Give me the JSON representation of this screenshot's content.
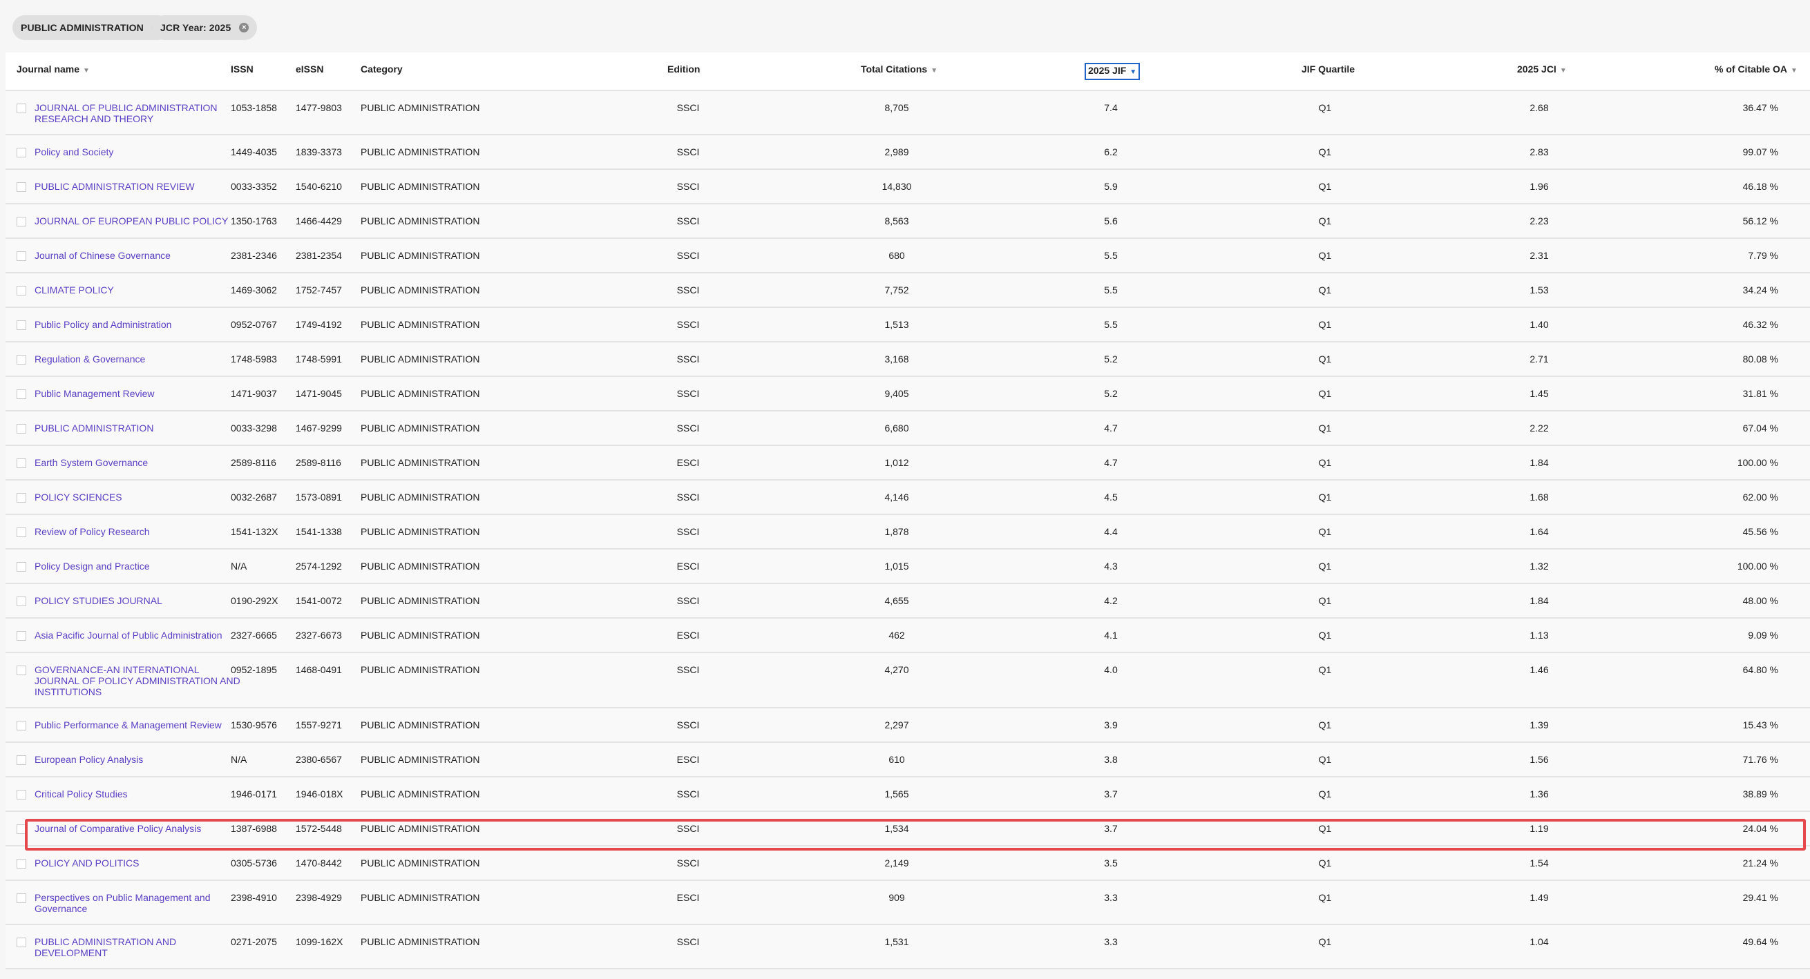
{
  "filters": [
    {
      "label": "PUBLIC ADMINISTRATION"
    },
    {
      "label": "JCR Year: 2025"
    }
  ],
  "columns": {
    "journal": "Journal name",
    "issn": "ISSN",
    "eissn": "eISSN",
    "category": "Category",
    "edition": "Edition",
    "citations": "Total Citations",
    "jif": "2025 JIF",
    "quartile": "JIF Quartile",
    "jci": "2025 JCI",
    "oa": "% of Citable OA"
  },
  "rows": [
    {
      "name": "JOURNAL OF PUBLIC ADMINISTRATION RESEARCH AND THEORY",
      "issn": "1053-1858",
      "eissn": "1477-9803",
      "category": "PUBLIC ADMINISTRATION",
      "edition": "SSCI",
      "citations": "8,705",
      "jif": "7.4",
      "quartile": "Q1",
      "jci": "2.68",
      "oa": "36.47 %"
    },
    {
      "name": "Policy and Society",
      "issn": "1449-4035",
      "eissn": "1839-3373",
      "category": "PUBLIC ADMINISTRATION",
      "edition": "SSCI",
      "citations": "2,989",
      "jif": "6.2",
      "quartile": "Q1",
      "jci": "2.83",
      "oa": "99.07 %"
    },
    {
      "name": "PUBLIC ADMINISTRATION REVIEW",
      "issn": "0033-3352",
      "eissn": "1540-6210",
      "category": "PUBLIC ADMINISTRATION",
      "edition": "SSCI",
      "citations": "14,830",
      "jif": "5.9",
      "quartile": "Q1",
      "jci": "1.96",
      "oa": "46.18 %"
    },
    {
      "name": "JOURNAL OF EUROPEAN PUBLIC POLICY",
      "issn": "1350-1763",
      "eissn": "1466-4429",
      "category": "PUBLIC ADMINISTRATION",
      "edition": "SSCI",
      "citations": "8,563",
      "jif": "5.6",
      "quartile": "Q1",
      "jci": "2.23",
      "oa": "56.12 %"
    },
    {
      "name": "Journal of Chinese Governance",
      "issn": "2381-2346",
      "eissn": "2381-2354",
      "category": "PUBLIC ADMINISTRATION",
      "edition": "SSCI",
      "citations": "680",
      "jif": "5.5",
      "quartile": "Q1",
      "jci": "2.31",
      "oa": "7.79 %"
    },
    {
      "name": "CLIMATE POLICY",
      "issn": "1469-3062",
      "eissn": "1752-7457",
      "category": "PUBLIC ADMINISTRATION",
      "edition": "SSCI",
      "citations": "7,752",
      "jif": "5.5",
      "quartile": "Q1",
      "jci": "1.53",
      "oa": "34.24 %"
    },
    {
      "name": "Public Policy and Administration",
      "issn": "0952-0767",
      "eissn": "1749-4192",
      "category": "PUBLIC ADMINISTRATION",
      "edition": "SSCI",
      "citations": "1,513",
      "jif": "5.5",
      "quartile": "Q1",
      "jci": "1.40",
      "oa": "46.32 %"
    },
    {
      "name": "Regulation & Governance",
      "issn": "1748-5983",
      "eissn": "1748-5991",
      "category": "PUBLIC ADMINISTRATION",
      "edition": "SSCI",
      "citations": "3,168",
      "jif": "5.2",
      "quartile": "Q1",
      "jci": "2.71",
      "oa": "80.08 %"
    },
    {
      "name": "Public Management Review",
      "issn": "1471-9037",
      "eissn": "1471-9045",
      "category": "PUBLIC ADMINISTRATION",
      "edition": "SSCI",
      "citations": "9,405",
      "jif": "5.2",
      "quartile": "Q1",
      "jci": "1.45",
      "oa": "31.81 %"
    },
    {
      "name": "PUBLIC ADMINISTRATION",
      "issn": "0033-3298",
      "eissn": "1467-9299",
      "category": "PUBLIC ADMINISTRATION",
      "edition": "SSCI",
      "citations": "6,680",
      "jif": "4.7",
      "quartile": "Q1",
      "jci": "2.22",
      "oa": "67.04 %"
    },
    {
      "name": "Earth System Governance",
      "issn": "2589-8116",
      "eissn": "2589-8116",
      "category": "PUBLIC ADMINISTRATION",
      "edition": "ESCI",
      "citations": "1,012",
      "jif": "4.7",
      "quartile": "Q1",
      "jci": "1.84",
      "oa": "100.00 %"
    },
    {
      "name": "POLICY SCIENCES",
      "issn": "0032-2687",
      "eissn": "1573-0891",
      "category": "PUBLIC ADMINISTRATION",
      "edition": "SSCI",
      "citations": "4,146",
      "jif": "4.5",
      "quartile": "Q1",
      "jci": "1.68",
      "oa": "62.00 %"
    },
    {
      "name": "Review of Policy Research",
      "issn": "1541-132X",
      "eissn": "1541-1338",
      "category": "PUBLIC ADMINISTRATION",
      "edition": "SSCI",
      "citations": "1,878",
      "jif": "4.4",
      "quartile": "Q1",
      "jci": "1.64",
      "oa": "45.56 %"
    },
    {
      "name": "Policy Design and Practice",
      "issn": "N/A",
      "eissn": "2574-1292",
      "category": "PUBLIC ADMINISTRATION",
      "edition": "ESCI",
      "citations": "1,015",
      "jif": "4.3",
      "quartile": "Q1",
      "jci": "1.32",
      "oa": "100.00 %"
    },
    {
      "name": "POLICY STUDIES JOURNAL",
      "issn": "0190-292X",
      "eissn": "1541-0072",
      "category": "PUBLIC ADMINISTRATION",
      "edition": "SSCI",
      "citations": "4,655",
      "jif": "4.2",
      "quartile": "Q1",
      "jci": "1.84",
      "oa": "48.00 %"
    },
    {
      "name": "Asia Pacific Journal of Public Administration",
      "issn": "2327-6665",
      "eissn": "2327-6673",
      "category": "PUBLIC ADMINISTRATION",
      "edition": "ESCI",
      "citations": "462",
      "jif": "4.1",
      "quartile": "Q1",
      "jci": "1.13",
      "oa": "9.09 %"
    },
    {
      "name": "GOVERNANCE-AN INTERNATIONAL JOURNAL OF POLICY ADMINISTRATION AND INSTITUTIONS",
      "issn": "0952-1895",
      "eissn": "1468-0491",
      "category": "PUBLIC ADMINISTRATION",
      "edition": "SSCI",
      "citations": "4,270",
      "jif": "4.0",
      "quartile": "Q1",
      "jci": "1.46",
      "oa": "64.80 %"
    },
    {
      "name": "Public Performance & Management Review",
      "issn": "1530-9576",
      "eissn": "1557-9271",
      "category": "PUBLIC ADMINISTRATION",
      "edition": "SSCI",
      "citations": "2,297",
      "jif": "3.9",
      "quartile": "Q1",
      "jci": "1.39",
      "oa": "15.43 %"
    },
    {
      "name": "European Policy Analysis",
      "issn": "N/A",
      "eissn": "2380-6567",
      "category": "PUBLIC ADMINISTRATION",
      "edition": "ESCI",
      "citations": "610",
      "jif": "3.8",
      "quartile": "Q1",
      "jci": "1.56",
      "oa": "71.76 %"
    },
    {
      "name": "Critical Policy Studies",
      "issn": "1946-0171",
      "eissn": "1946-018X",
      "category": "PUBLIC ADMINISTRATION",
      "edition": "SSCI",
      "citations": "1,565",
      "jif": "3.7",
      "quartile": "Q1",
      "jci": "1.36",
      "oa": "38.89 %"
    },
    {
      "name": "Journal of Comparative Policy Analysis",
      "issn": "1387-6988",
      "eissn": "1572-5448",
      "category": "PUBLIC ADMINISTRATION",
      "edition": "SSCI",
      "citations": "1,534",
      "jif": "3.7",
      "quartile": "Q1",
      "jci": "1.19",
      "oa": "24.04 %"
    },
    {
      "name": "POLICY AND POLITICS",
      "issn": "0305-5736",
      "eissn": "1470-8442",
      "category": "PUBLIC ADMINISTRATION",
      "edition": "SSCI",
      "citations": "2,149",
      "jif": "3.5",
      "quartile": "Q1",
      "jci": "1.54",
      "oa": "21.24 %"
    },
    {
      "name": "Perspectives on Public Management and Governance",
      "issn": "2398-4910",
      "eissn": "2398-4929",
      "category": "PUBLIC ADMINISTRATION",
      "edition": "ESCI",
      "citations": "909",
      "jif": "3.3",
      "quartile": "Q1",
      "jci": "1.49",
      "oa": "29.41 %"
    },
    {
      "name": "PUBLIC ADMINISTRATION AND DEVELOPMENT",
      "issn": "0271-2075",
      "eissn": "1099-162X",
      "category": "PUBLIC ADMINISTRATION",
      "edition": "SSCI",
      "citations": "1,531",
      "jif": "3.3",
      "quartile": "Q1",
      "jci": "1.04",
      "oa": "49.64 %"
    }
  ]
}
